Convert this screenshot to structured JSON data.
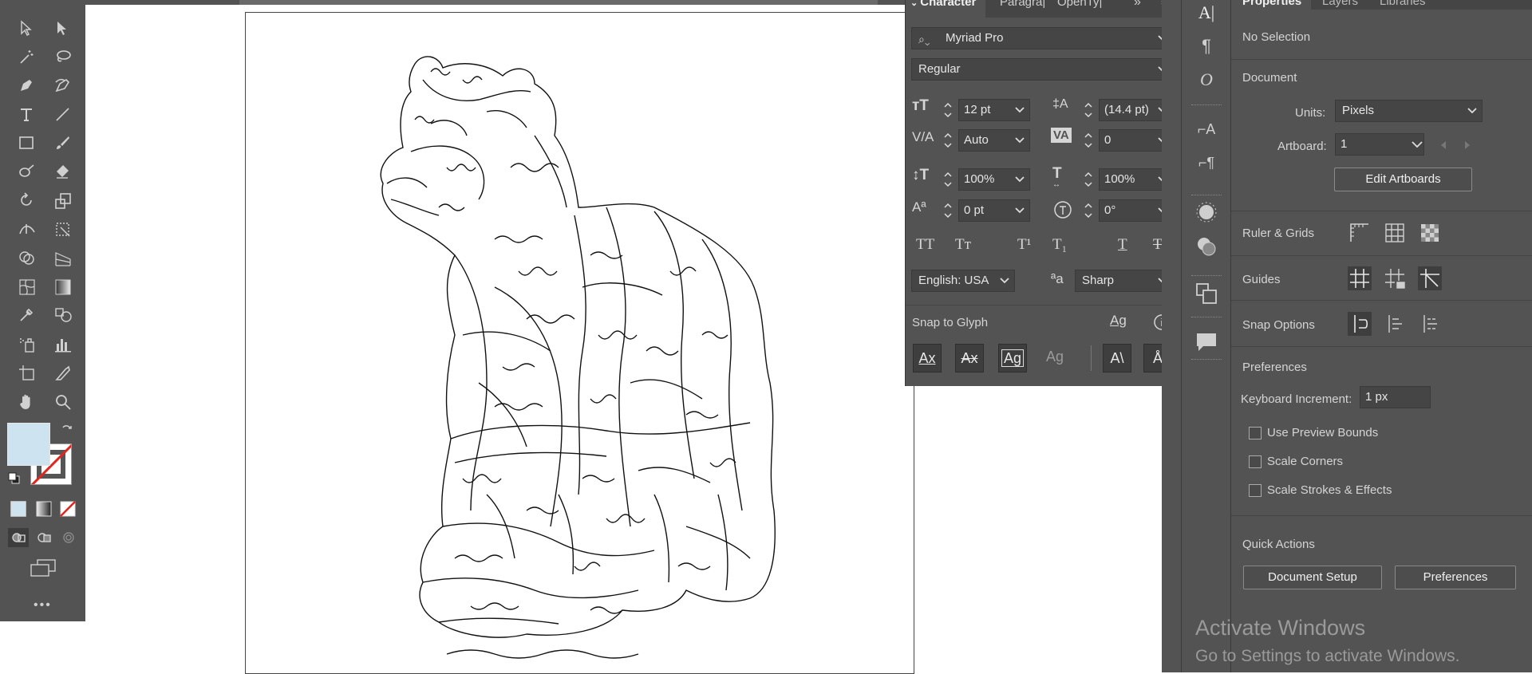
{
  "character_panel": {
    "tabs": [
      "Character",
      "Paragra|",
      "OpenTy|"
    ],
    "font_family": "Myriad Pro",
    "font_style": "Regular",
    "font_size": "12 pt",
    "leading": "(14.4 pt)",
    "kerning": "Auto",
    "tracking": "0",
    "vertical_scale": "100%",
    "horizontal_scale": "100%",
    "baseline_shift": "0 pt",
    "rotation": "0°",
    "language": "English: USA",
    "antialiasing": "Sharp",
    "snap_to_glyph_label": "Snap to Glyph",
    "aa_glyph": "ªa"
  },
  "properties_panel": {
    "tabs": [
      "Properties",
      "Layers",
      "Libraries"
    ],
    "selection": "No Selection",
    "document_heading": "Document",
    "units_label": "Units:",
    "units_value": "Pixels",
    "artboard_label": "Artboard:",
    "artboard_value": "1",
    "edit_artboards": "Edit Artboards",
    "ruler_grids": "Ruler & Grids",
    "guides": "Guides",
    "snap_options": "Snap Options",
    "preferences_heading": "Preferences",
    "keyboard_increment_label": "Keyboard Increment:",
    "keyboard_increment_value": "1 px",
    "use_preview_bounds": "Use Preview Bounds",
    "scale_corners": "Scale Corners",
    "scale_strokes": "Scale Strokes & Effects",
    "quick_actions": "Quick Actions",
    "document_setup": "Document Setup",
    "preferences_btn": "Preferences"
  },
  "watermark": {
    "line1": "Activate Windows",
    "line2": "Go to Settings to activate Windows."
  },
  "colors": {
    "fill": "#cde3ef",
    "panel_bg": "#535353",
    "field_bg": "#454545"
  },
  "toolbar": {
    "more_label": "•••"
  }
}
